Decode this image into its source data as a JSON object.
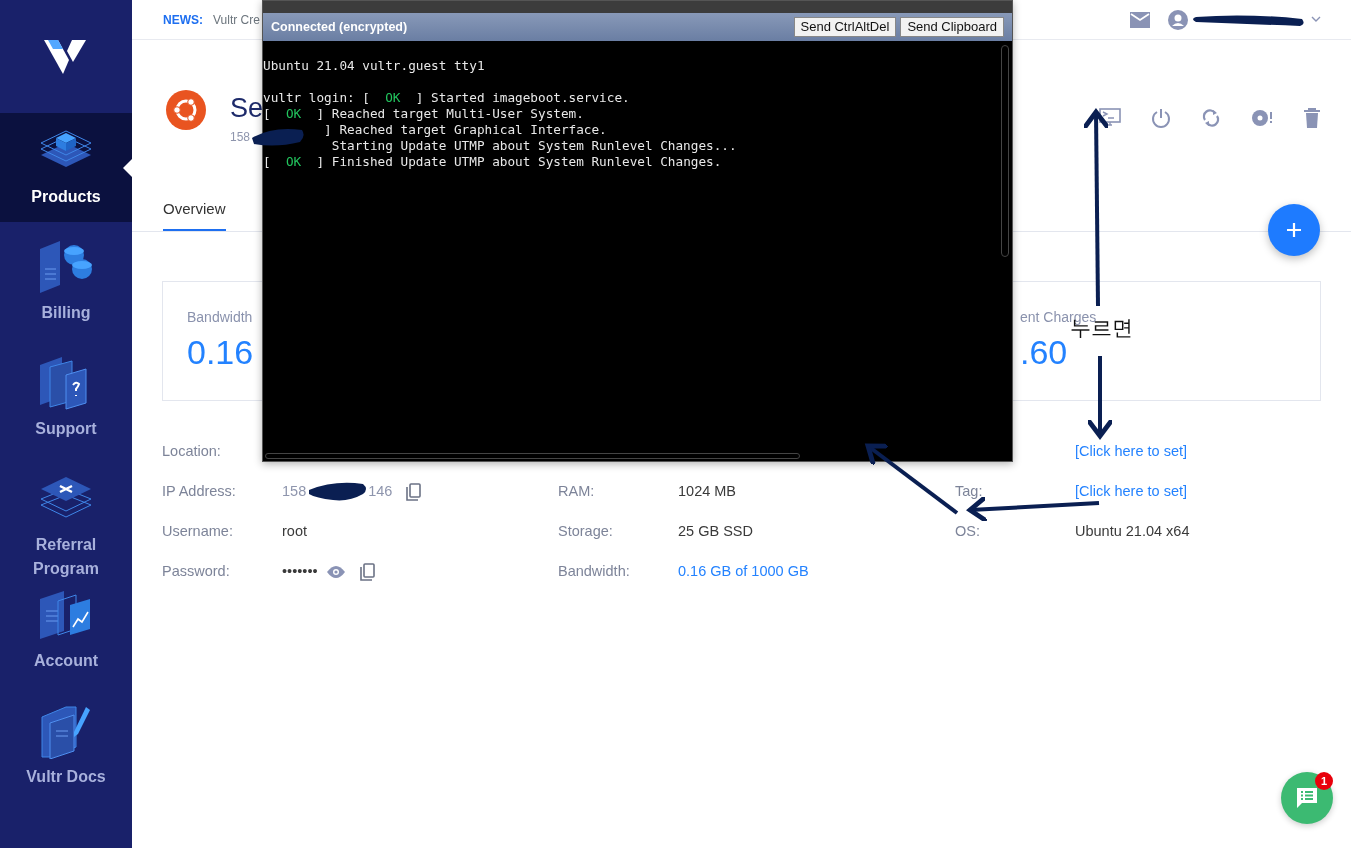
{
  "sidebar": {
    "items": [
      {
        "label": "Products",
        "selected": true,
        "kind": "products"
      },
      {
        "label": "Billing",
        "selected": false,
        "kind": "billing"
      },
      {
        "label": "Support",
        "selected": false,
        "kind": "support"
      },
      {
        "label": "Referral Program",
        "selected": false,
        "kind": "referral"
      },
      {
        "label": "Account",
        "selected": false,
        "kind": "account"
      },
      {
        "label": "Vultr Docs",
        "selected": false,
        "kind": "docs"
      }
    ]
  },
  "topbar": {
    "news_label": "NEWS:",
    "news_text": "Vultr Cre"
  },
  "server": {
    "title": "Se",
    "subtitle": "158"
  },
  "tabs": [
    {
      "label": "Overview",
      "selected": true
    }
  ],
  "stats": [
    {
      "label": "Bandwidth",
      "value": "0.16"
    },
    {
      "label": "ent Charges",
      "value": ".60"
    }
  ],
  "details": [
    {
      "col_1": {
        "label": "Location:"
      },
      "col_3": {
        "value": "[Click here to set]",
        "kind": "link"
      }
    },
    {
      "col_1": {
        "label": "IP Address:",
        "kind": "ip",
        "parts": [
          "158",
          "146"
        ]
      },
      "col_2": {
        "label": "RAM:",
        "value": "1024 MB",
        "kind": "text"
      },
      "col_3": {
        "label": "Tag:",
        "value": "[Click here to set]",
        "kind": "link"
      }
    },
    {
      "col_1": {
        "label": "Username:",
        "value": "root",
        "kind": "text"
      },
      "col_2": {
        "label": "Storage:",
        "value": "25 GB SSD",
        "kind": "text"
      },
      "col_3": {
        "label": "OS:",
        "value": "Ubuntu 21.04 x64",
        "kind": "text"
      }
    },
    {
      "col_1": {
        "label": "Password:",
        "value": "•••••••",
        "kind": "password"
      },
      "col_2": {
        "label": "Bandwidth:",
        "value": "0.16 GB of 1000 GB",
        "kind": "link"
      }
    }
  ],
  "console": {
    "status": "Connected (encrypted)",
    "buttons": [
      "Send CtrlAltDel",
      "Send Clipboard"
    ],
    "lines": [
      {
        "text": "Ubuntu 21.04 vultr.guest tty1"
      },
      {
        "prefix": "vultr login: [  ",
        "status": "OK",
        "text": "  ] Started imageboot.service.",
        "gap_before": true
      },
      {
        "prefix": "[  ",
        "status": "OK",
        "text": "  ] Reached target Multi-User System."
      },
      {
        "text": "        ] Reached target Graphical Interface."
      },
      {
        "text": "         Starting Update UTMP about System Runlevel Changes..."
      },
      {
        "prefix": "[  ",
        "status": "OK",
        "text": "  ] Finished Update UTMP about System Runlevel Changes."
      }
    ]
  },
  "annotation": {
    "text": "누르면"
  },
  "chat": {
    "badge": "1"
  }
}
